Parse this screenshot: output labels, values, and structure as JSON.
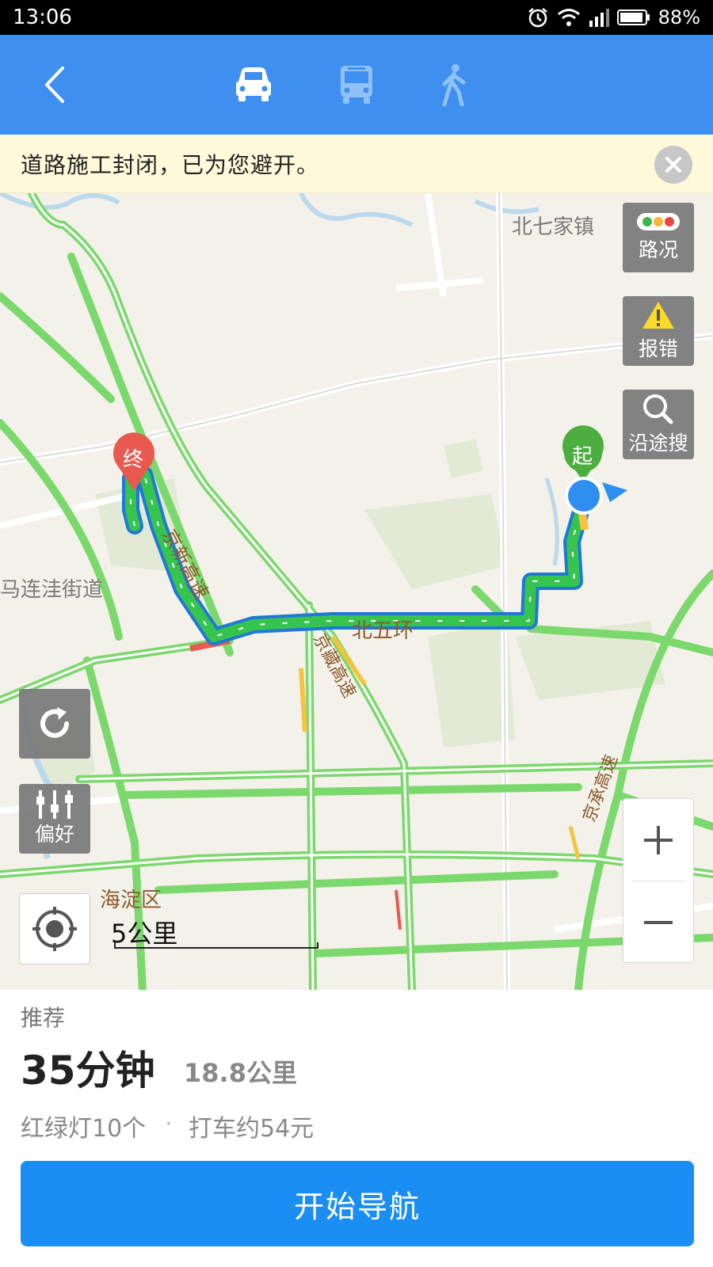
{
  "status_bar": {
    "time": "13:06",
    "battery": "88%",
    "icons": [
      "alarm-icon",
      "wifi-icon",
      "signal-icon",
      "battery-icon"
    ]
  },
  "top_nav": {
    "back_icon": "back-arrow-icon",
    "modes": [
      {
        "name": "car",
        "icon": "car-icon",
        "active": true
      },
      {
        "name": "bus",
        "icon": "bus-icon",
        "active": false
      },
      {
        "name": "walk",
        "icon": "walk-icon",
        "active": false
      }
    ],
    "background_color": "#3f8ff1"
  },
  "notice": {
    "text": "道路施工封闭，已为您避开。",
    "close_icon": "close-icon"
  },
  "map": {
    "place_labels": {
      "beiqijia": "北七家镇",
      "malianwa": "马连洼街道",
      "haidian": "海淀区"
    },
    "road_labels": {
      "jingxin": "京新高速",
      "north_fifth_ring": "北五环",
      "jingzang": "京藏高速",
      "jingcheng": "京承高速"
    },
    "start_marker": "起",
    "end_marker": "终",
    "scale_label": "5公里",
    "route_color": "#37c44e",
    "side_buttons": [
      {
        "id": "traffic",
        "label": "路况",
        "icon": "traffic-light-icon"
      },
      {
        "id": "report",
        "label": "报错",
        "icon": "warning-icon"
      },
      {
        "id": "search",
        "label": "沿途搜",
        "icon": "search-icon"
      }
    ],
    "preference_label": "偏好",
    "refresh_icon": "refresh-icon",
    "locate_icon": "locate-icon",
    "zoom_in_icon": "plus-icon",
    "zoom_out_icon": "minus-icon"
  },
  "route_summary": {
    "recommend_label": "推荐",
    "duration": "35分钟",
    "distance": "18.8公里",
    "traffic_lights": "红绿灯10个",
    "separator": "·",
    "taxi_fare": "打车约54元",
    "start_nav_label": "开始导航",
    "button_color": "#1a8ef3"
  }
}
